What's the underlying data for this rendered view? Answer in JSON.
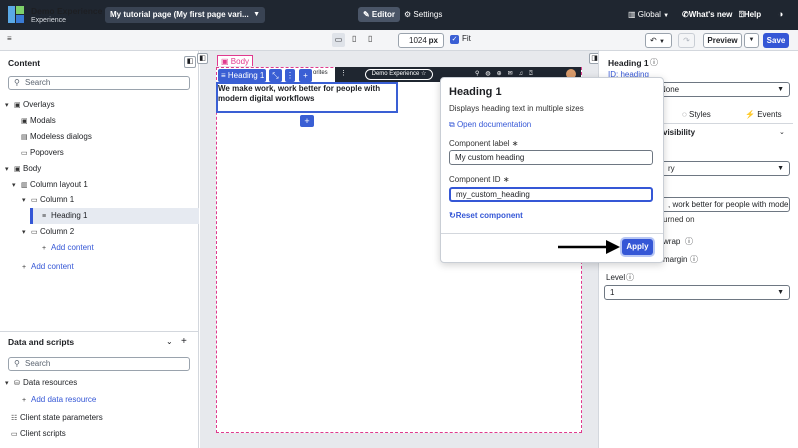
{
  "topbar": {
    "app_title": "Demo Experience",
    "app_subtitle": "Experience",
    "page_selector": "My tutorial page (My first page vari...",
    "editor_label": "Editor",
    "settings_label": "Settings",
    "global_label": "Global",
    "whats_new_label": "What's new",
    "help_label": "Help"
  },
  "toolbar": {
    "menu_glyph": "≡",
    "width_value": "1024",
    "width_unit": "px",
    "fit_label": "Fit",
    "preview_label": "Preview",
    "save_label": "Save"
  },
  "content_panel": {
    "title": "Content",
    "search_placeholder": "Search",
    "tree": [
      {
        "label": "Overlays"
      },
      {
        "label": "Modals"
      },
      {
        "label": "Modeless dialogs"
      },
      {
        "label": "Popovers"
      },
      {
        "label": "Body"
      },
      {
        "label": "Column layout 1"
      },
      {
        "label": "Column 1"
      },
      {
        "label": "Heading 1"
      },
      {
        "label": "Column 2"
      },
      {
        "label": "Add content"
      },
      {
        "label": "Add content"
      }
    ]
  },
  "data_panel": {
    "title": "Data and scripts",
    "search_placeholder": "Search",
    "items": [
      {
        "label": "Data resources"
      },
      {
        "label": "Add data resource"
      },
      {
        "label": "Client state parameters"
      },
      {
        "label": "Client scripts"
      }
    ]
  },
  "canvas": {
    "body_tag": "Body",
    "component_tag": "Heading 1",
    "heading_text": "We make work, work better for people with modern digital workflows",
    "preview_nav_text": "orites",
    "preview_pill": "Demo Experience ☆"
  },
  "right_panel": {
    "title": "Heading 1",
    "id_label": "ID: heading",
    "select_value": "None",
    "tab_styles": "Styles",
    "tab_events": "Events",
    "visibility_label": "visibility",
    "dropdown_value": "ry",
    "text_value": ", work better for people with mode",
    "turned_on": "urned on",
    "wrap_label": "wrap",
    "margin_label": "margin",
    "level_label": "Level",
    "level_value": "1"
  },
  "popover": {
    "title": "Heading 1",
    "description": "Displays heading text in multiple sizes",
    "doc_link": "Open documentation",
    "label_field_label": "Component label",
    "label_field_value": "My custom heading",
    "id_field_label": "Component ID",
    "id_field_value": "my_custom_heading",
    "reset_label": "Reset component",
    "apply_label": "Apply"
  },
  "colors": {
    "topbar": "#1f2630",
    "accent": "#3557d6",
    "body_outline": "#e03a8e"
  }
}
